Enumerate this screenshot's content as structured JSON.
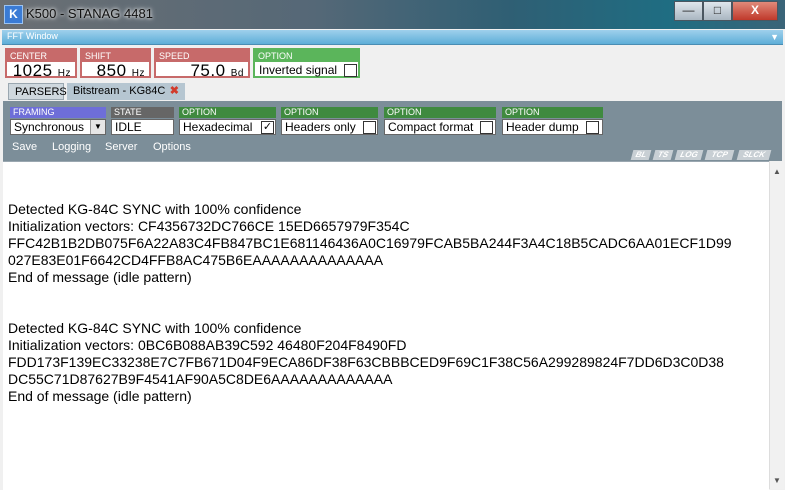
{
  "window": {
    "title": "K500 - STANAG 4481",
    "icon_letter": "K",
    "min": "—",
    "max": "□",
    "close": "X"
  },
  "fft": {
    "label": "FFT Window",
    "arrow": "▼"
  },
  "params": {
    "center": {
      "caption": "CENTER",
      "value": "1025",
      "unit": "Hz"
    },
    "shift": {
      "caption": "SHIFT",
      "value": "850",
      "unit": "Hz"
    },
    "speed": {
      "caption": "SPEED",
      "value": "75.0",
      "unit": "Bd"
    },
    "option": {
      "caption": "OPTION",
      "label": "Inverted signal",
      "checked": false
    }
  },
  "tabs": {
    "parsers": "PARSERS",
    "bitstream": "Bitstream - KG84C",
    "close": "✖"
  },
  "controls": {
    "framing": {
      "caption": "FRAMING",
      "value": "Synchronous",
      "arrow": "▼"
    },
    "state": {
      "caption": "STATE",
      "value": "IDLE"
    },
    "hex": {
      "caption": "OPTION",
      "label": "Hexadecimal",
      "checked": true,
      "mark": "✓"
    },
    "headers": {
      "caption": "OPTION",
      "label": "Headers only",
      "checked": false
    },
    "compact": {
      "caption": "OPTION",
      "label": "Compact format",
      "checked": false
    },
    "dump": {
      "caption": "OPTION",
      "label": "Header dump",
      "checked": false
    }
  },
  "menu": {
    "save": "Save",
    "logging": "Logging",
    "server": "Server",
    "options": "Options"
  },
  "badges": [
    "BL",
    "TS",
    "LOG",
    "TCP",
    "SLCK"
  ],
  "output": [
    "Detected KG-84C SYNC with 100% confidence",
    "Initialization vectors: CF4356732DC766CE 15ED6657979F354C",
    "FFC42B1B2DB075F6A22A83C4FB847BC1E681146436A0C16979FCAB5BA244F3A4C18B5CADC6AA01ECF1D99",
    "027E83E01F6642CD4FFB8AC475B6EAAAAAAAAAAAAAA",
    "End of message (idle pattern)",
    "",
    "Detected KG-84C SYNC with 100% confidence",
    "Initialization vectors: 0BC6B088AB39C592 46480F204F8490FD",
    "FDD173F139EC33238E7C7FB671D04F9ECA86DF38F63CBBBCED9F69C1F38C56A299289824F7DD6D3C0D38",
    "DC55C71D87627B9F4541AF90A5C8DE6AAAAAAAAAAAAA",
    "End of message (idle pattern)"
  ],
  "scroll": {
    "up": "▲",
    "down": "▼"
  }
}
